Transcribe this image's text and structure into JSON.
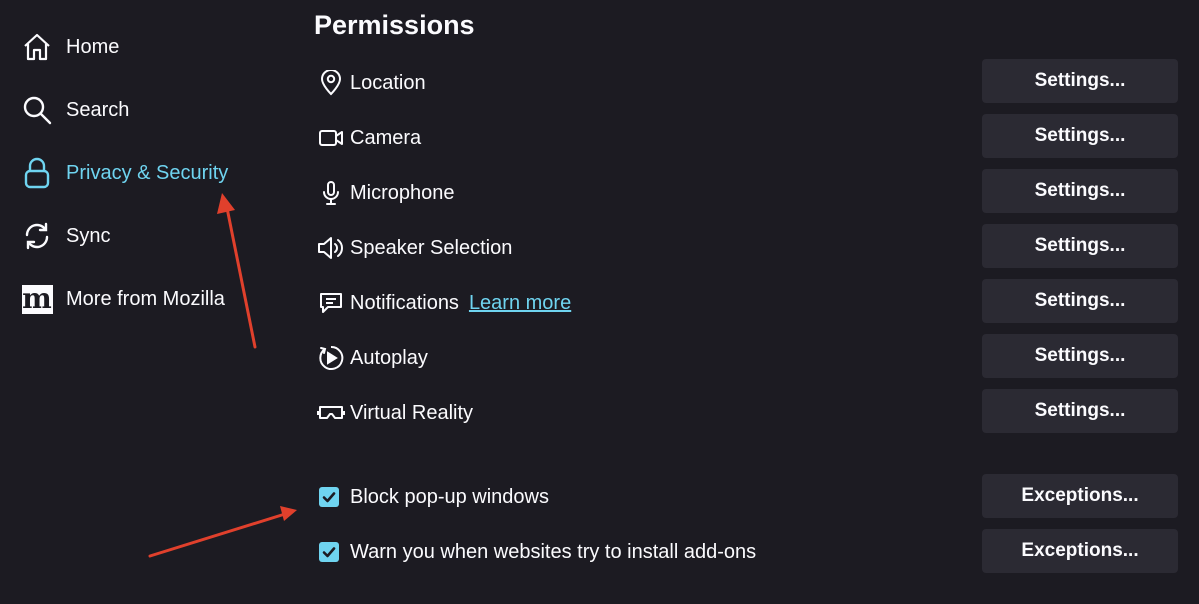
{
  "sidebar": {
    "items": [
      {
        "label": "Home",
        "icon": "home-icon"
      },
      {
        "label": "Search",
        "icon": "search-icon"
      },
      {
        "label": "Privacy & Security",
        "icon": "lock-icon",
        "active": true
      },
      {
        "label": "Sync",
        "icon": "sync-icon"
      },
      {
        "label": "More from Mozilla",
        "icon": "mozilla-m-icon"
      }
    ]
  },
  "permissions": {
    "title": "Permissions",
    "items": [
      {
        "label": "Location",
        "icon": "location-icon",
        "button": "Settings..."
      },
      {
        "label": "Camera",
        "icon": "camera-icon",
        "button": "Settings..."
      },
      {
        "label": "Microphone",
        "icon": "microphone-icon",
        "button": "Settings..."
      },
      {
        "label": "Speaker Selection",
        "icon": "speaker-icon",
        "button": "Settings..."
      },
      {
        "label": "Notifications",
        "icon": "notification-icon",
        "button": "Settings...",
        "link": "Learn more"
      },
      {
        "label": "Autoplay",
        "icon": "autoplay-icon",
        "button": "Settings..."
      },
      {
        "label": "Virtual Reality",
        "icon": "vr-headset-icon",
        "button": "Settings..."
      }
    ],
    "checkboxes": [
      {
        "label": "Block pop-up windows",
        "checked": true,
        "button": "Exceptions..."
      },
      {
        "label": "Warn you when websites try to install add-ons",
        "checked": true,
        "button": "Exceptions..."
      }
    ]
  },
  "mozilla_logo_letter": "m",
  "colors": {
    "background": "#1c1b22",
    "text": "#fbfbfe",
    "accent": "#6fd4f0",
    "button_bg": "#2b2a33",
    "annotation_arrow": "#e0402c"
  }
}
